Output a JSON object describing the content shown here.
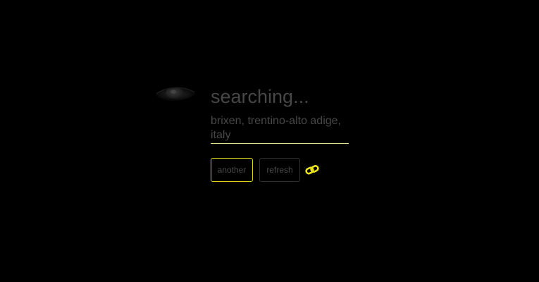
{
  "status_text": "searching...",
  "location": {
    "text": "brixen, trentino-alto adige, italy"
  },
  "buttons": {
    "another_label": "another",
    "refresh_label": "refresh"
  },
  "icons": {
    "eye": "eye-icon",
    "link": "link-icon"
  },
  "colors": {
    "background": "#000000",
    "text": "#474747",
    "accent": "#e8e21c",
    "underline": "#e2e08a"
  }
}
